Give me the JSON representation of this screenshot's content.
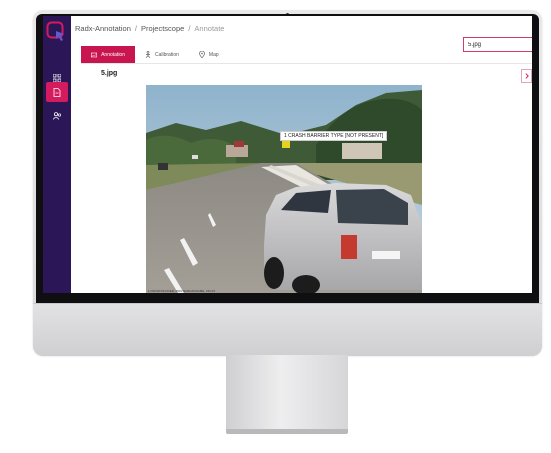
{
  "breadcrumb": {
    "items": [
      "Radx-Annotation",
      "Projectscope",
      "Annotate"
    ],
    "separator": "/"
  },
  "search": {
    "value": "5.jpg"
  },
  "tabs": [
    {
      "label": "Annotation",
      "icon": "image-icon",
      "active": true
    },
    {
      "label": "Calibration",
      "icon": "person-icon",
      "active": false
    },
    {
      "label": "Map",
      "icon": "map-pin-icon",
      "active": false
    }
  ],
  "sidebar": {
    "items": [
      {
        "icon": "grid-icon",
        "active": false
      },
      {
        "icon": "document-icon",
        "active": true
      },
      {
        "icon": "users-icon",
        "active": false
      }
    ]
  },
  "image": {
    "filename": "5.jpg",
    "annotation_label": "1 CRASH BARRIER TYPE [NOT PRESENT]",
    "caption": "1 FRONTOFFICER, ROUTE/ROADNAME, KM XX"
  },
  "colors": {
    "sidebar": "#2b1657",
    "accent": "#c8144f",
    "active_icon_bg": "#d41b5e"
  }
}
